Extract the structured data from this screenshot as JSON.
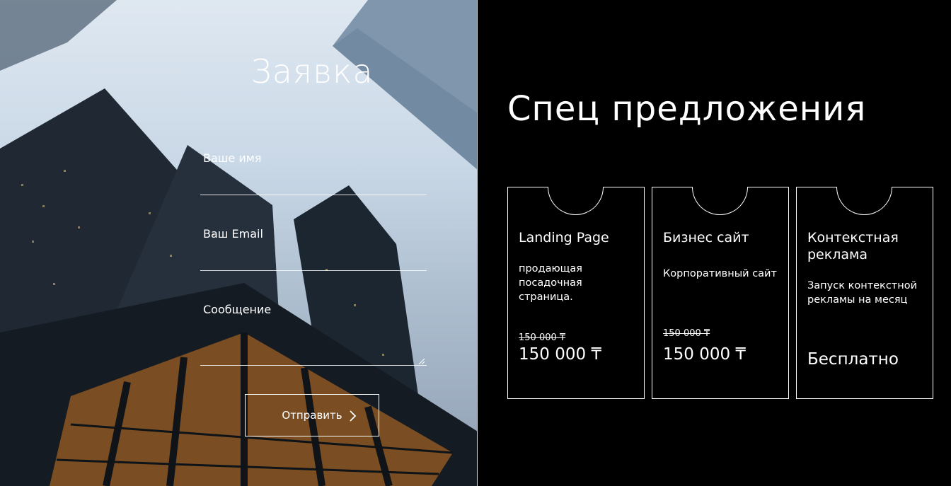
{
  "form": {
    "title": "Заявка",
    "name_label": "Ваше имя",
    "email_label": "Ваш Email",
    "message_label": "Сообщение",
    "submit_label": "Отправить"
  },
  "offers": {
    "title": "Спец предложения",
    "cards": [
      {
        "title": "Landing Page",
        "description": "продающая посадочная страница.",
        "old_price": "150 000 ₸",
        "price": "150 000 ₸"
      },
      {
        "title": "Бизнес сайт",
        "description": "Корпоративный сайт",
        "old_price": "150 000 ₸",
        "price": "150 000 ₸"
      },
      {
        "title": "Контекстная реклама",
        "description": "Запуск контекстной рекламы на месяц",
        "price": "Бесплатно"
      }
    ]
  },
  "colors": {
    "background": "#000000",
    "text": "#ffffff",
    "border": "#ffffff"
  },
  "icons": {
    "submit": "chevron-right-icon"
  }
}
